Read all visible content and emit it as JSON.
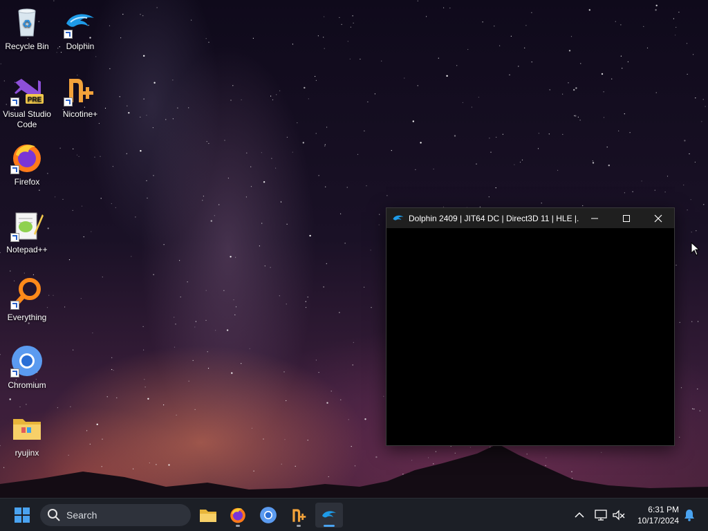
{
  "desktop": {
    "icons": [
      {
        "label": "Recycle Bin"
      },
      {
        "label": "Dolphin"
      },
      {
        "label": "Visual Studio Code"
      },
      {
        "label": "Nicotine+"
      },
      {
        "label": "Firefox"
      },
      {
        "label": "Notepad++"
      },
      {
        "label": "Everything"
      },
      {
        "label": "Chromium"
      },
      {
        "label": "ryujinx"
      }
    ],
    "vscode_badge": "PRE"
  },
  "window": {
    "title": "Dolphin 2409 | JIT64 DC | Direct3D 11 | HLE |...",
    "minimize_icon": "minimize-icon",
    "maximize_icon": "maximize-icon",
    "close_icon": "close-icon"
  },
  "taskbar": {
    "start_icon": "windows-start-icon",
    "search_placeholder": "Search",
    "pinned": [
      "file-explorer-icon",
      "firefox-icon",
      "chromium-icon",
      "nicotine-icon",
      "dolphin-icon"
    ],
    "active_app": "dolphin-icon"
  },
  "tray": {
    "time": "6:31 PM",
    "date": "10/17/2024",
    "icons": [
      "chevron-up-icon",
      "network-icon",
      "volume-muted-icon",
      "notification-bell-icon"
    ]
  },
  "colors": {
    "accent": "#4aa3f0",
    "taskbar_bg": "#1c1f26",
    "titlebar_bg": "#1f1f1f"
  }
}
